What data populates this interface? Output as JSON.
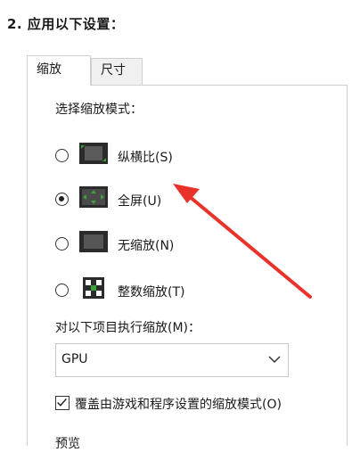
{
  "step": {
    "heading": "2. 应用以下设置："
  },
  "tabs": [
    {
      "label": "缩放",
      "active": true
    },
    {
      "label": "尺寸",
      "active": false
    }
  ],
  "scaling": {
    "mode_label": "选择缩放模式：",
    "options": [
      {
        "label": "纵横比(S)",
        "selected": false,
        "icon": "aspect-ratio-icon"
      },
      {
        "label": "全屏(U)",
        "selected": true,
        "icon": "full-screen-icon"
      },
      {
        "label": "无缩放(N)",
        "selected": false,
        "icon": "no-scaling-icon"
      },
      {
        "label": "整数缩放(T)",
        "selected": false,
        "icon": "integer-scaling-icon"
      }
    ],
    "perform_on_label": "对以下项目执行缩放(M)：",
    "perform_on_value": "GPU",
    "override_label": "覆盖由游戏和程序设置的缩放模式(O)",
    "override_checked": true,
    "next_section_label": "预览"
  },
  "colors": {
    "annotation_arrow": "#e8322a",
    "icon_green": "#3ca03c"
  }
}
